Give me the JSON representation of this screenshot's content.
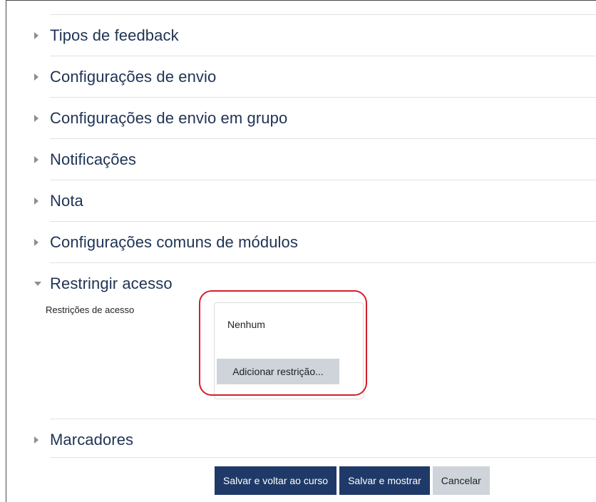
{
  "sections": [
    {
      "label": "Tipos de feedback",
      "expanded": false
    },
    {
      "label": "Configurações de envio",
      "expanded": false
    },
    {
      "label": "Configurações de envio em grupo",
      "expanded": false
    },
    {
      "label": "Notificações",
      "expanded": false
    },
    {
      "label": "Nota",
      "expanded": false
    },
    {
      "label": "Configurações comuns de módulos",
      "expanded": false
    },
    {
      "label": "Restringir acesso",
      "expanded": true
    },
    {
      "label": "Marcadores",
      "expanded": false
    }
  ],
  "restrict": {
    "field_label": "Restrições de acesso",
    "current_value": "Nenhum",
    "add_button": "Adicionar restrição..."
  },
  "actions": {
    "save_return": "Salvar e voltar ao curso",
    "save_display": "Salvar e mostrar",
    "cancel": "Cancelar"
  },
  "colors": {
    "heading": "#1f3354",
    "primary_button": "#1f3a68",
    "secondary_button": "#ced4da",
    "highlight": "#d21f2a"
  }
}
